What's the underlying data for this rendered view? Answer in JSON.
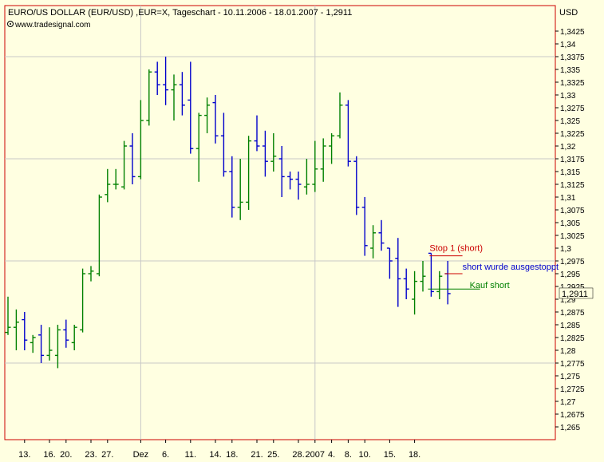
{
  "header": {
    "title": "EURO/US DOLLAR (EUR/USD) ,EUR=X, Tageschart - 10.11.2006 - 18.01.2007 - 1,2911",
    "source": "www.tradesignal.com",
    "currency": "USD"
  },
  "colors": {
    "up_bar": "#008000",
    "down_bar": "#0000cc",
    "frame": "#cc0000",
    "grid": "#c8c8c8",
    "background": "#ffffe1",
    "stop_line": "#cc0000",
    "buy_line": "#008000",
    "stop_text": "#cc0000",
    "short_text": "#0000cc",
    "buy_text": "#008000"
  },
  "chart_data": {
    "type": "ohlc",
    "title": "EURO/US DOLLAR (EUR/USD) ,EUR=X, Tageschart - 10.11.2006 - 18.01.2007 - 1,2911",
    "ylabel": "USD",
    "ylim": [
      1.2625,
      1.3475
    ],
    "y_ticks": [
      "1,265",
      "1,2675",
      "1,27",
      "1,2725",
      "1,275",
      "1,2775",
      "1,28",
      "1,2825",
      "1,285",
      "1,2875",
      "1,29",
      "1,2925",
      "1,295",
      "1,2975",
      "1,3",
      "1,3025",
      "1,305",
      "1,3075",
      "1,31",
      "1,3125",
      "1,315",
      "1,3175",
      "1,32",
      "1,3225",
      "1,325",
      "1,3275",
      "1,33",
      "1,3325",
      "1,335",
      "1,3375",
      "1,34",
      "1,3425"
    ],
    "last_price_label": "1,2911",
    "last_price": 1.2911,
    "x_ticks": [
      {
        "label": "13.",
        "index": 2
      },
      {
        "label": "16.",
        "index": 5
      },
      {
        "label": "20.",
        "index": 7
      },
      {
        "label": "23.",
        "index": 10
      },
      {
        "label": "27.",
        "index": 12
      },
      {
        "label": "Dez",
        "index": 16
      },
      {
        "label": "6.",
        "index": 19
      },
      {
        "label": "11.",
        "index": 22
      },
      {
        "label": "14.",
        "index": 25
      },
      {
        "label": "18.",
        "index": 27
      },
      {
        "label": "21.",
        "index": 30
      },
      {
        "label": "25.",
        "index": 32
      },
      {
        "label": "28.",
        "index": 35
      },
      {
        "label": "2007",
        "index": 37
      },
      {
        "label": "4.",
        "index": 39
      },
      {
        "label": "8.",
        "index": 41
      },
      {
        "label": "10.",
        "index": 43
      },
      {
        "label": "15.",
        "index": 46
      },
      {
        "label": "18.",
        "index": 49
      }
    ],
    "vgrid_indices": [
      16,
      37
    ],
    "hgrid_values": [
      1.2775,
      1.2975,
      1.3175,
      1.3375
    ],
    "bars": [
      {
        "o": 1.2835,
        "h": 1.2905,
        "l": 1.283,
        "c": 1.2845
      },
      {
        "o": 1.2845,
        "h": 1.288,
        "l": 1.28,
        "c": 1.2855
      },
      {
        "o": 1.286,
        "h": 1.2875,
        "l": 1.28,
        "c": 1.282
      },
      {
        "o": 1.2815,
        "h": 1.283,
        "l": 1.2795,
        "c": 1.2825
      },
      {
        "o": 1.283,
        "h": 1.285,
        "l": 1.2775,
        "c": 1.279
      },
      {
        "o": 1.279,
        "h": 1.2845,
        "l": 1.278,
        "c": 1.28
      },
      {
        "o": 1.279,
        "h": 1.285,
        "l": 1.2765,
        "c": 1.284
      },
      {
        "o": 1.284,
        "h": 1.286,
        "l": 1.2805,
        "c": 1.282
      },
      {
        "o": 1.2815,
        "h": 1.285,
        "l": 1.28,
        "c": 1.2845
      },
      {
        "o": 1.284,
        "h": 1.296,
        "l": 1.2835,
        "c": 1.295
      },
      {
        "o": 1.295,
        "h": 1.2965,
        "l": 1.2935,
        "c": 1.2955
      },
      {
        "o": 1.295,
        "h": 1.3105,
        "l": 1.2945,
        "c": 1.31
      },
      {
        "o": 1.3105,
        "h": 1.3155,
        "l": 1.309,
        "c": 1.3125
      },
      {
        "o": 1.3125,
        "h": 1.3155,
        "l": 1.3115,
        "c": 1.3125
      },
      {
        "o": 1.312,
        "h": 1.321,
        "l": 1.3115,
        "c": 1.32
      },
      {
        "o": 1.32,
        "h": 1.3225,
        "l": 1.3125,
        "c": 1.314
      },
      {
        "o": 1.314,
        "h": 1.329,
        "l": 1.3135,
        "c": 1.325
      },
      {
        "o": 1.325,
        "h": 1.335,
        "l": 1.324,
        "c": 1.3345
      },
      {
        "o": 1.3345,
        "h": 1.3365,
        "l": 1.33,
        "c": 1.332
      },
      {
        "o": 1.332,
        "h": 1.3375,
        "l": 1.328,
        "c": 1.331
      },
      {
        "o": 1.331,
        "h": 1.334,
        "l": 1.325,
        "c": 1.332
      },
      {
        "o": 1.332,
        "h": 1.3345,
        "l": 1.326,
        "c": 1.328
      },
      {
        "o": 1.329,
        "h": 1.3365,
        "l": 1.3185,
        "c": 1.3195
      },
      {
        "o": 1.3195,
        "h": 1.3265,
        "l": 1.313,
        "c": 1.326
      },
      {
        "o": 1.326,
        "h": 1.3295,
        "l": 1.3225,
        "c": 1.328
      },
      {
        "o": 1.3285,
        "h": 1.33,
        "l": 1.3205,
        "c": 1.322
      },
      {
        "o": 1.322,
        "h": 1.3265,
        "l": 1.314,
        "c": 1.315
      },
      {
        "o": 1.315,
        "h": 1.318,
        "l": 1.306,
        "c": 1.308
      },
      {
        "o": 1.308,
        "h": 1.3175,
        "l": 1.3055,
        "c": 1.309
      },
      {
        "o": 1.309,
        "h": 1.322,
        "l": 1.3075,
        "c": 1.321
      },
      {
        "o": 1.321,
        "h": 1.326,
        "l": 1.319,
        "c": 1.32
      },
      {
        "o": 1.32,
        "h": 1.323,
        "l": 1.314,
        "c": 1.317
      },
      {
        "o": 1.317,
        "h": 1.3225,
        "l": 1.315,
        "c": 1.318
      },
      {
        "o": 1.3175,
        "h": 1.32,
        "l": 1.31,
        "c": 1.314
      },
      {
        "o": 1.314,
        "h": 1.315,
        "l": 1.3115,
        "c": 1.3135
      },
      {
        "o": 1.3135,
        "h": 1.315,
        "l": 1.3095,
        "c": 1.3125
      },
      {
        "o": 1.312,
        "h": 1.3175,
        "l": 1.3105,
        "c": 1.3125
      },
      {
        "o": 1.3125,
        "h": 1.321,
        "l": 1.311,
        "c": 1.3155
      },
      {
        "o": 1.3155,
        "h": 1.3215,
        "l": 1.313,
        "c": 1.32
      },
      {
        "o": 1.32,
        "h": 1.3225,
        "l": 1.3165,
        "c": 1.322
      },
      {
        "o": 1.322,
        "h": 1.3305,
        "l": 1.3215,
        "c": 1.328
      },
      {
        "o": 1.328,
        "h": 1.329,
        "l": 1.316,
        "c": 1.317
      },
      {
        "o": 1.317,
        "h": 1.318,
        "l": 1.3065,
        "c": 1.308
      },
      {
        "o": 1.308,
        "h": 1.31,
        "l": 1.2985,
        "c": 1.3005
      },
      {
        "o": 1.3,
        "h": 1.3045,
        "l": 1.298,
        "c": 1.303
      },
      {
        "o": 1.303,
        "h": 1.3055,
        "l": 1.2995,
        "c": 1.301
      },
      {
        "o": 1.3,
        "h": 1.3,
        "l": 1.294,
        "c": 1.2975
      },
      {
        "o": 1.298,
        "h": 1.302,
        "l": 1.2885,
        "c": 1.294
      },
      {
        "o": 1.294,
        "h": 1.296,
        "l": 1.29,
        "c": 1.292
      },
      {
        "o": 1.29,
        "h": 1.2955,
        "l": 1.287,
        "c": 1.2935
      },
      {
        "o": 1.2935,
        "h": 1.2975,
        "l": 1.2915,
        "c": 1.2945
      },
      {
        "o": 1.299,
        "h": 1.299,
        "l": 1.2905,
        "c": 1.2915
      },
      {
        "o": 1.2915,
        "h": 1.2955,
        "l": 1.29,
        "c": 1.2945
      },
      {
        "o": 1.295,
        "h": 1.2975,
        "l": 1.289,
        "c": 1.2911
      }
    ],
    "annotations": {
      "stop": {
        "label": "Stop 1 (short)",
        "value": 1.2985,
        "from_index": 51,
        "to_index": 54
      },
      "short_stopped": {
        "label": "short wurde ausgestoppt",
        "value": 1.295,
        "from_index": 53,
        "to_index": 54
      },
      "buy": {
        "label": "Kauf short",
        "value": 1.292,
        "from_index": 51,
        "to_index": 54
      }
    }
  }
}
